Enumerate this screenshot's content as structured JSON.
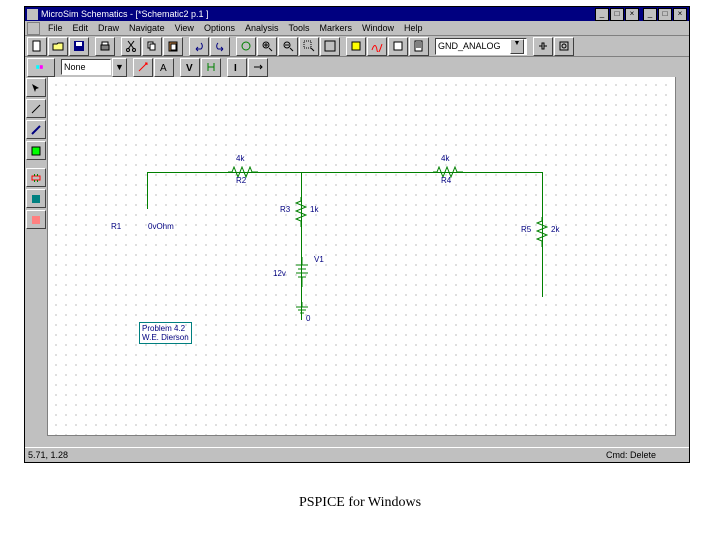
{
  "title": "MicroSim Schematics - [*Schematic2 p.1 ]",
  "menu": {
    "file": "File",
    "edit": "Edit",
    "draw": "Draw",
    "navigate": "Navigate",
    "view": "View",
    "options": "Options",
    "analysis": "Analysis",
    "tools": "Tools",
    "markers": "Markers",
    "window": "Window",
    "help": "Help"
  },
  "gnd_select": "GND_ANALOG",
  "layer_field": "None",
  "status": {
    "coords": "5.71, 1.28",
    "cmd": "Cmd: Delete"
  },
  "components": {
    "r1_name": "R1",
    "r1_val": "0vOhm",
    "r2_name": "R2",
    "r2_val": "4k",
    "r3_name": "R3",
    "r3_val": "1k",
    "r4_name": "R4",
    "r4_val": "4k",
    "r5_name": "R5",
    "r5_val": "2k",
    "v1_name": "V1",
    "v1_val": "12v",
    "gnd": "0"
  },
  "annotation": {
    "l1": "Problem 4.2",
    "l2": "W.E. Dierson"
  },
  "caption": "PSPICE for Windows"
}
